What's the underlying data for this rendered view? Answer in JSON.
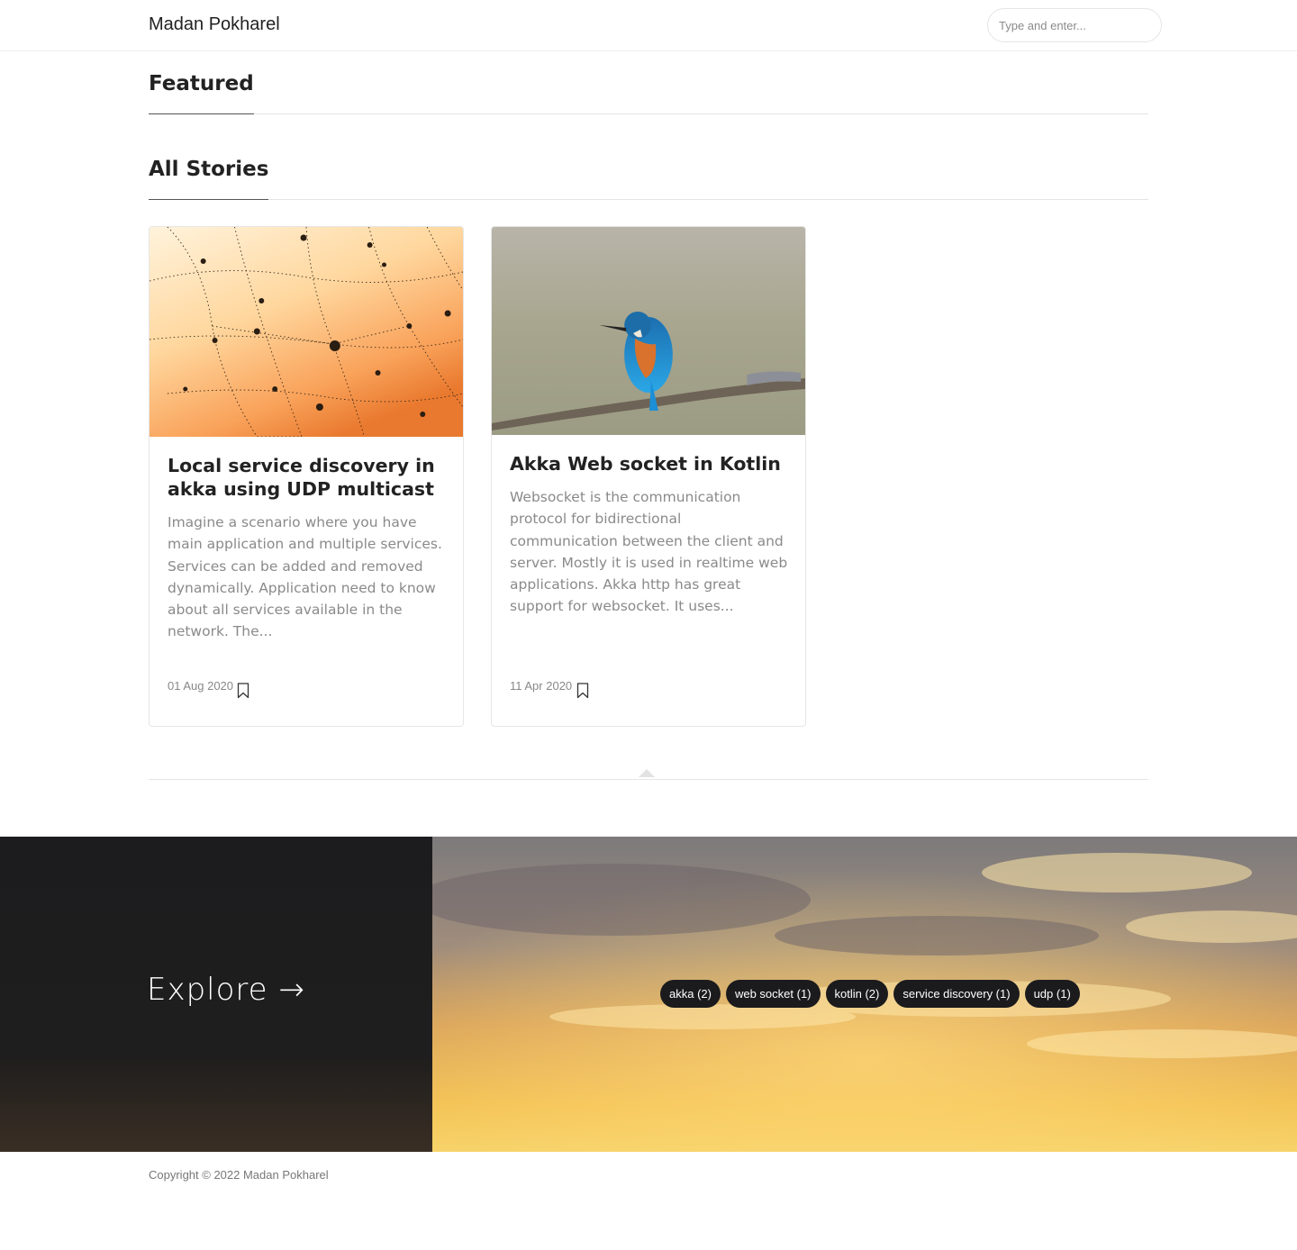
{
  "header": {
    "brand": "Madan Pokharel",
    "search_placeholder": "Type and enter..."
  },
  "sections": {
    "featured": "Featured",
    "all_stories": "All Stories"
  },
  "posts": [
    {
      "title": "Local service discovery in akka using UDP multicast",
      "excerpt": "Imagine a scenario where you have main application and multiple services. Services can be added and removed dynamically. Application need to know about all services available in the network. The...",
      "date": "01 Aug 2020",
      "image_icon": "spider-web-dew-image"
    },
    {
      "title": "Akka Web socket in Kotlin",
      "excerpt": "Websocket is the communication protocol for bidirectional communication between the client and server. Mostly it is used in realtime web applications. Akka http has great support for websocket. It uses...",
      "date": "11 Apr 2020",
      "image_icon": "kingfisher-bird-image"
    }
  ],
  "explore": {
    "title": "Explore →",
    "tags": [
      "akka (2)",
      "web socket (1)",
      "kotlin (2)",
      "service discovery (1)",
      "udp (1)"
    ]
  },
  "footer": {
    "copyright": "Copyright © 2022 Madan Pokharel"
  },
  "colors": {
    "text": "#222222",
    "muted": "#8a8a8a",
    "tag_bg": "#1b1b1d",
    "explore_left": "#1c1c1e"
  }
}
